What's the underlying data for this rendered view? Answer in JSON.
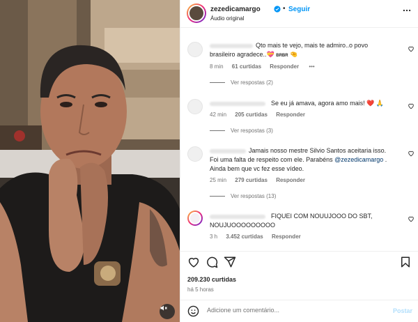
{
  "header": {
    "username": "zezedicamargo",
    "separator": "•",
    "follow_label": "Seguir",
    "audio_label": "Áudio original",
    "more_icon": "more-horizontal-icon"
  },
  "video": {
    "mute_icon": "speaker-muted-icon"
  },
  "comments": [
    {
      "text_parts": [
        "Qto mais te vejo, mais te admiro..o povo",
        "brasileiro agradece..💝 ",
        "BRBR",
        "🤏"
      ],
      "time": "8 min",
      "likes": "61 curtidas",
      "reply_label": "Responder",
      "extra": "•••",
      "replies": "Ver respostas (2)"
    },
    {
      "text_parts": [
        "Se eu já amava, agora amo mais! ",
        "❤️",
        " 🙏"
      ],
      "time": "42 min",
      "likes": "205 curtidas",
      "reply_label": "Responder",
      "replies": "Ver respostas (3)"
    },
    {
      "line1": "Jamais nosso mestre Silvio Santos aceitaria isso.",
      "line2_prefix": "Foi uma falta de respeito com ele. Parabéns ",
      "mention": "@zezedicamargo",
      "line2_suffix": " .",
      "line3": "Ainda bem que vc fez esse vídeo.",
      "time": "25 min",
      "likes": "279 curtidas",
      "reply_label": "Responder",
      "replies": "Ver respostas (13)"
    },
    {
      "line1": "FIQUEI COM NOUUJOOO DO SBT,",
      "line2": "NOUJUOOOOOOOOO",
      "time": "3 h",
      "likes": "3.452 curtidas",
      "reply_label": "Responder"
    }
  ],
  "actions": {
    "like_icon": "heart-icon",
    "comment_icon": "comment-icon",
    "share_icon": "share-icon",
    "save_icon": "bookmark-icon",
    "likes": "209.230 curtidas",
    "time": "há 5 horas"
  },
  "add_comment": {
    "placeholder": "Adicione um comentário...",
    "post_label": "Postar",
    "emoji_icon": "emoji-icon"
  },
  "colors": {
    "accent": "#0095f6",
    "muted": "#737373",
    "mention": "#00376b",
    "heart_red": "#ed4956"
  }
}
